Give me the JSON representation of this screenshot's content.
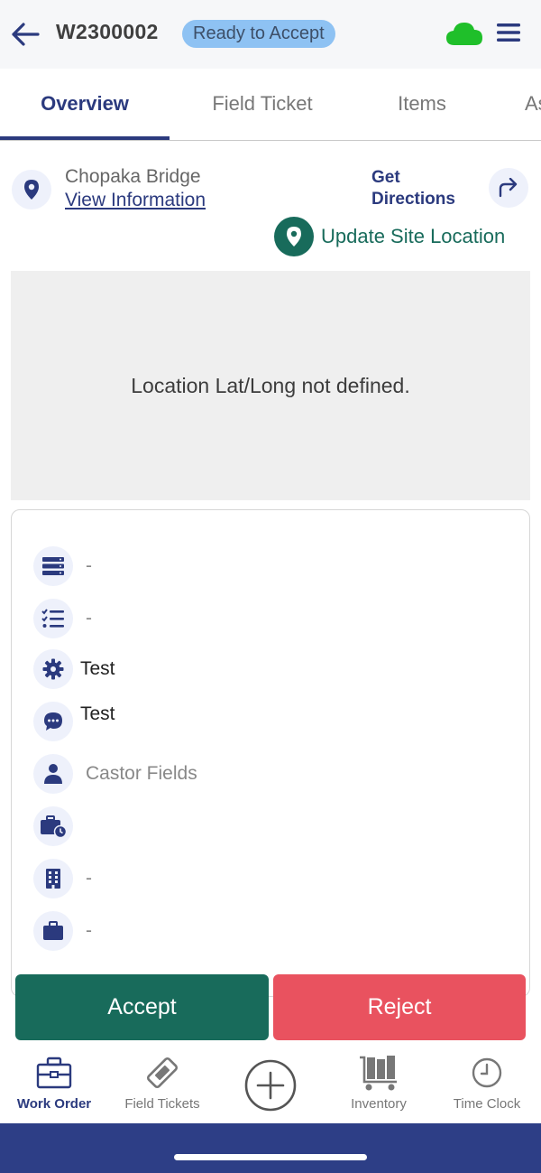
{
  "header": {
    "work_order_id": "W2300002",
    "status": "Ready to Accept",
    "colors": {
      "status_bg": "#8ec2f3",
      "sync_cloud": "#1fbf2a",
      "brand": "#2b3a7e"
    }
  },
  "tabs": [
    {
      "label": "Overview",
      "active": true
    },
    {
      "label": "Field Ticket",
      "active": false
    },
    {
      "label": "Items",
      "active": false
    },
    {
      "label": "As",
      "active": false
    }
  ],
  "location": {
    "name": "Chopaka Bridge",
    "view_info_label": "View Information",
    "get_directions_line1": "Get",
    "get_directions_line2": "Directions",
    "update_site_label": "Update Site Location",
    "map_message": "Location Lat/Long not defined."
  },
  "details": [
    {
      "icon": "server-icon",
      "value": "-"
    },
    {
      "icon": "checklist-icon",
      "value": "-"
    },
    {
      "icon": "gear-icon",
      "value": "Test"
    },
    {
      "icon": "chat-icon",
      "value": "Test"
    },
    {
      "icon": "person-icon",
      "value": "Castor Fields"
    },
    {
      "icon": "briefcase-clock-icon",
      "value": ""
    },
    {
      "icon": "building-icon",
      "value": "-"
    },
    {
      "icon": "briefcase-icon",
      "value": "-"
    }
  ],
  "actions": {
    "accept_label": "Accept",
    "reject_label": "Reject",
    "accept_color": "#186b5b",
    "reject_color": "#e9525f"
  },
  "bottom_nav": [
    {
      "label": "Work Order",
      "icon": "toolbox-icon",
      "active": true
    },
    {
      "label": "Field Tickets",
      "icon": "ticket-icon",
      "active": false
    },
    {
      "label": "",
      "icon": "plus-circle-icon",
      "active": false
    },
    {
      "label": "Inventory",
      "icon": "cart-icon",
      "active": false
    },
    {
      "label": "Time Clock",
      "icon": "clock-icon",
      "active": false
    }
  ]
}
